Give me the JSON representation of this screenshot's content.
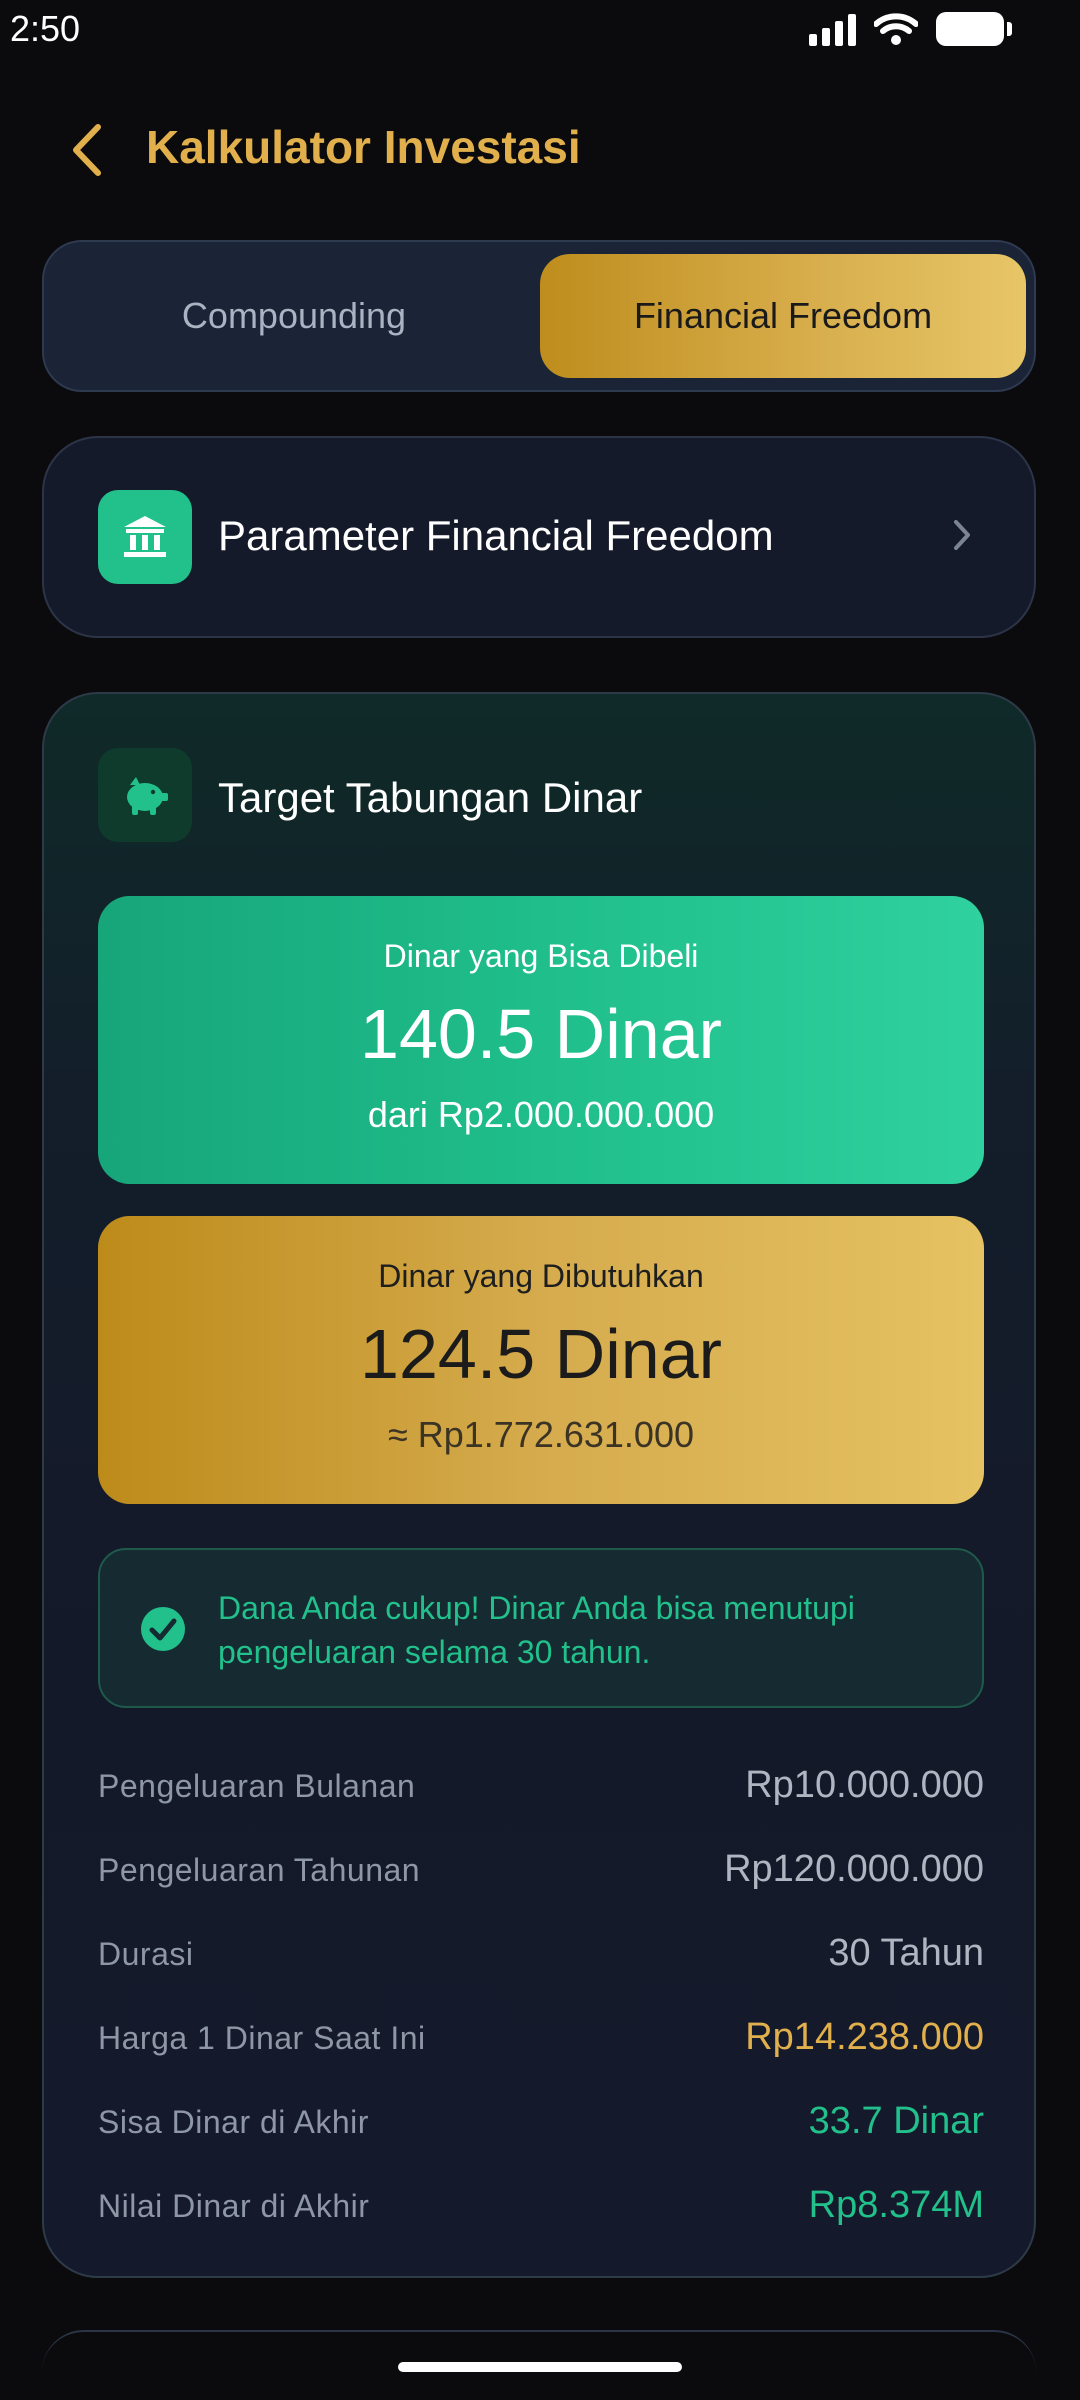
{
  "status_bar": {
    "time": "2:50"
  },
  "header": {
    "title": "Kalkulator Investasi"
  },
  "tabs": [
    {
      "label": "Compounding"
    },
    {
      "label": "Financial Freedom"
    }
  ],
  "parameter": {
    "title": "Parameter Financial Freedom"
  },
  "target": {
    "title": "Target Tabungan Dinar",
    "buyable": {
      "label": "Dinar yang Bisa Dibeli",
      "value": "140.5 Dinar",
      "sub": "dari Rp2.000.000.000"
    },
    "needed": {
      "label": "Dinar yang Dibutuhkan",
      "value": "124.5 Dinar",
      "sub": "≈ Rp1.772.631.000"
    },
    "notice": "Dana Anda cukup! Dinar Anda bisa menutupi pengeluaran selama 30 tahun.",
    "rows": [
      {
        "label": "Pengeluaran Bulanan",
        "value": "Rp10.000.000"
      },
      {
        "label": "Pengeluaran Tahunan",
        "value": "Rp120.000.000"
      },
      {
        "label": "Durasi",
        "value": "30 Tahun"
      },
      {
        "label": "Harga 1 Dinar Saat Ini",
        "value": "Rp14.238.000"
      },
      {
        "label": "Sisa Dinar di Akhir",
        "value": "33.7 Dinar"
      },
      {
        "label": "Nilai Dinar di Akhir",
        "value": "Rp8.374M"
      }
    ]
  },
  "colors": {
    "accent_gold": "#e1b04c",
    "accent_green": "#22c08b",
    "background": "#0b0b0d"
  }
}
